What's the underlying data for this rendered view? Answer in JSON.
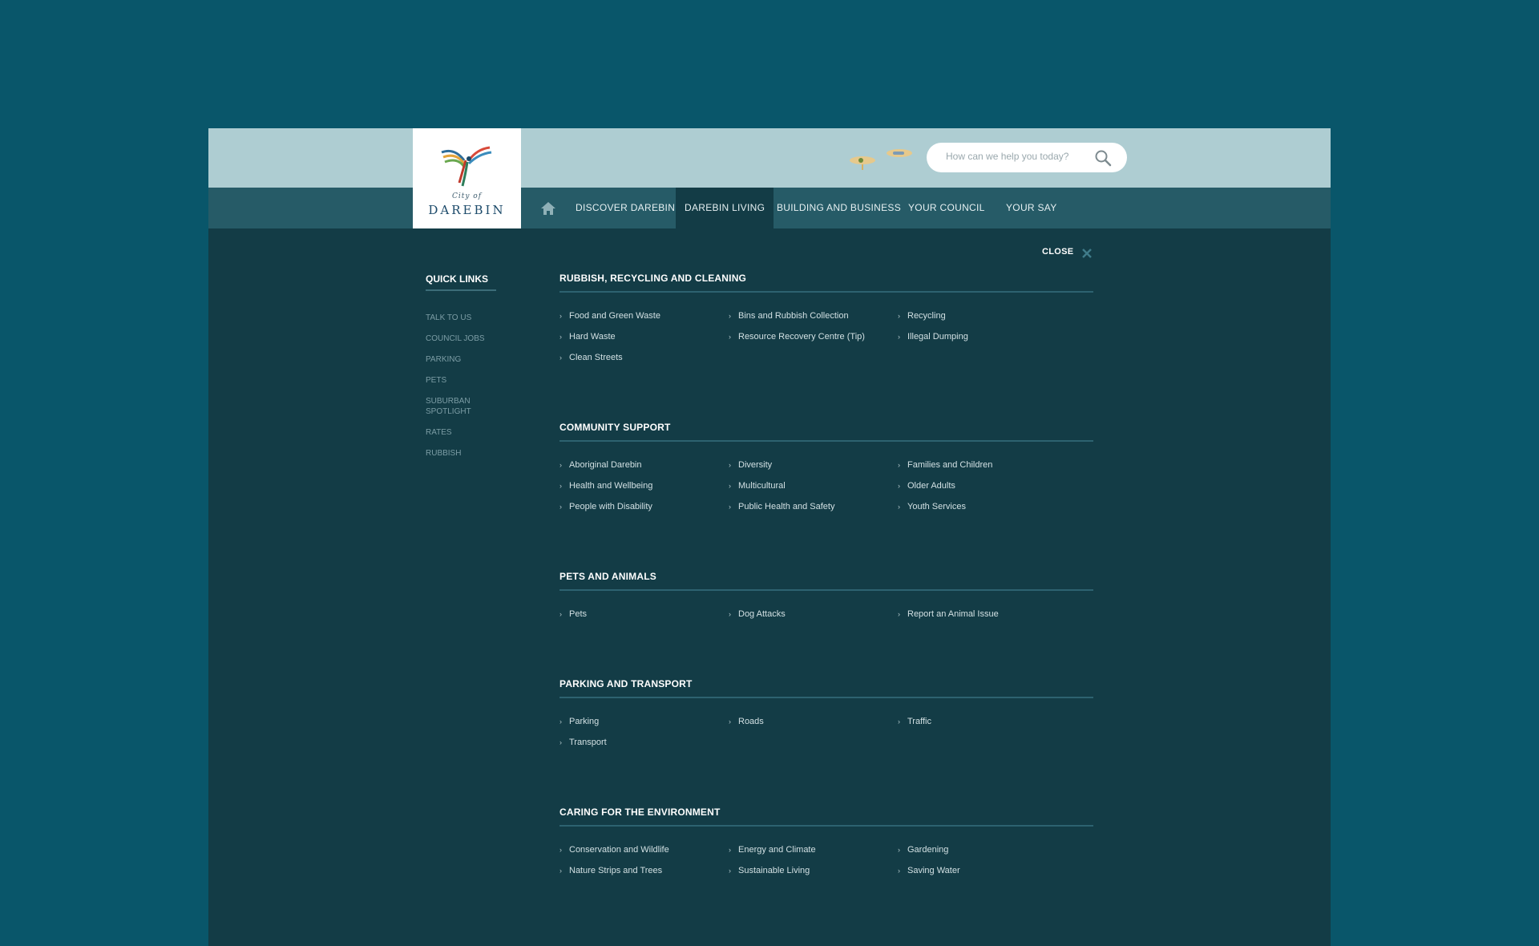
{
  "logo": {
    "city": "City of",
    "name": "DAREBIN"
  },
  "search": {
    "placeholder": "How can we help you today?"
  },
  "nav": {
    "items": [
      {
        "label": "DISCOVER DAREBIN"
      },
      {
        "label": "DAREBIN LIVING",
        "active": true
      },
      {
        "label": "BUILDING AND BUSINESS"
      },
      {
        "label": "YOUR COUNCIL"
      },
      {
        "label": "YOUR SAY"
      }
    ]
  },
  "close_label": "CLOSE",
  "quick_links": {
    "title": "QUICK LINKS",
    "items": [
      "TALK TO US",
      "COUNCIL JOBS",
      "PARKING",
      "PETS",
      "SUBURBAN SPOTLIGHT",
      "RATES",
      "RUBBISH"
    ]
  },
  "sections": [
    {
      "title": "RUBBISH, RECYCLING AND CLEANING",
      "links": [
        "Food and Green Waste",
        "Bins and Rubbish Collection",
        "Recycling",
        "Hard Waste",
        "Resource Recovery Centre (Tip)",
        "Illegal Dumping",
        "Clean Streets"
      ]
    },
    {
      "title": "COMMUNITY SUPPORT",
      "links": [
        "Aboriginal Darebin",
        "Diversity",
        "Families and Children",
        "Health and Wellbeing",
        "Multicultural",
        "Older Adults",
        "People with Disability",
        "Public Health and Safety",
        "Youth Services"
      ]
    },
    {
      "title": "PETS AND ANIMALS",
      "links": [
        "Pets",
        "Dog Attacks",
        "Report an Animal Issue"
      ]
    },
    {
      "title": "PARKING AND TRANSPORT",
      "links": [
        "Parking",
        "Roads",
        "Traffic",
        "Transport"
      ]
    },
    {
      "title": "CARING FOR THE ENVIRONMENT",
      "links": [
        "Conservation and Wildlife",
        "Energy and Climate",
        "Gardening",
        "Nature Strips and Trees",
        "Sustainable Living",
        "Saving Water"
      ]
    }
  ],
  "colors": {
    "page_bg": "#09566a",
    "topbar": "#aecdd2",
    "navbar": "#265b67",
    "menu_bg": "#133c46"
  }
}
